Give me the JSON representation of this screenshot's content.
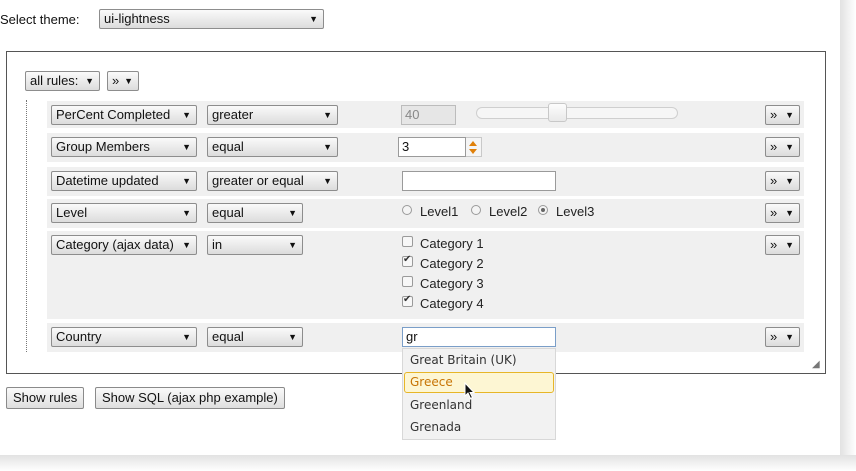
{
  "theme": {
    "label": "Select theme:",
    "value": "ui-lightness"
  },
  "toolbar": {
    "group_op": "all rules:",
    "group_menu": "»"
  },
  "rules": [
    {
      "field": "PerCent Completed",
      "op": "greater",
      "value": "40",
      "menu": "»"
    },
    {
      "field": "Group Members",
      "op": "equal",
      "value": "3",
      "menu": "»"
    },
    {
      "field": "Datetime updated",
      "op": "greater or equal",
      "value": "",
      "menu": "»"
    },
    {
      "field": "Level",
      "op": "equal",
      "menu": "»",
      "options": [
        {
          "label": "Level1",
          "checked": false
        },
        {
          "label": "Level2",
          "checked": false
        },
        {
          "label": "Level3",
          "checked": true
        }
      ]
    },
    {
      "field": "Category (ajax data)",
      "op": "in",
      "menu": "»",
      "options": [
        {
          "label": "Category 1",
          "checked": false
        },
        {
          "label": "Category 2",
          "checked": true
        },
        {
          "label": "Category 3",
          "checked": false
        },
        {
          "label": "Category 4",
          "checked": true
        }
      ]
    },
    {
      "field": "Country",
      "op": "equal",
      "value": "gr",
      "menu": "»"
    }
  ],
  "autocomplete": {
    "items": [
      "Great Britain (UK)",
      "Greece",
      "Greenland",
      "Grenada"
    ],
    "highlighted": "Greece"
  },
  "buttons": {
    "show_rules": "Show rules",
    "show_sql": "Show SQL (ajax php example)"
  },
  "colors": {
    "spinner_arrows": "#e0800a",
    "highlight_border": "#e7b627",
    "highlight_fill": "#fdf6d3"
  }
}
